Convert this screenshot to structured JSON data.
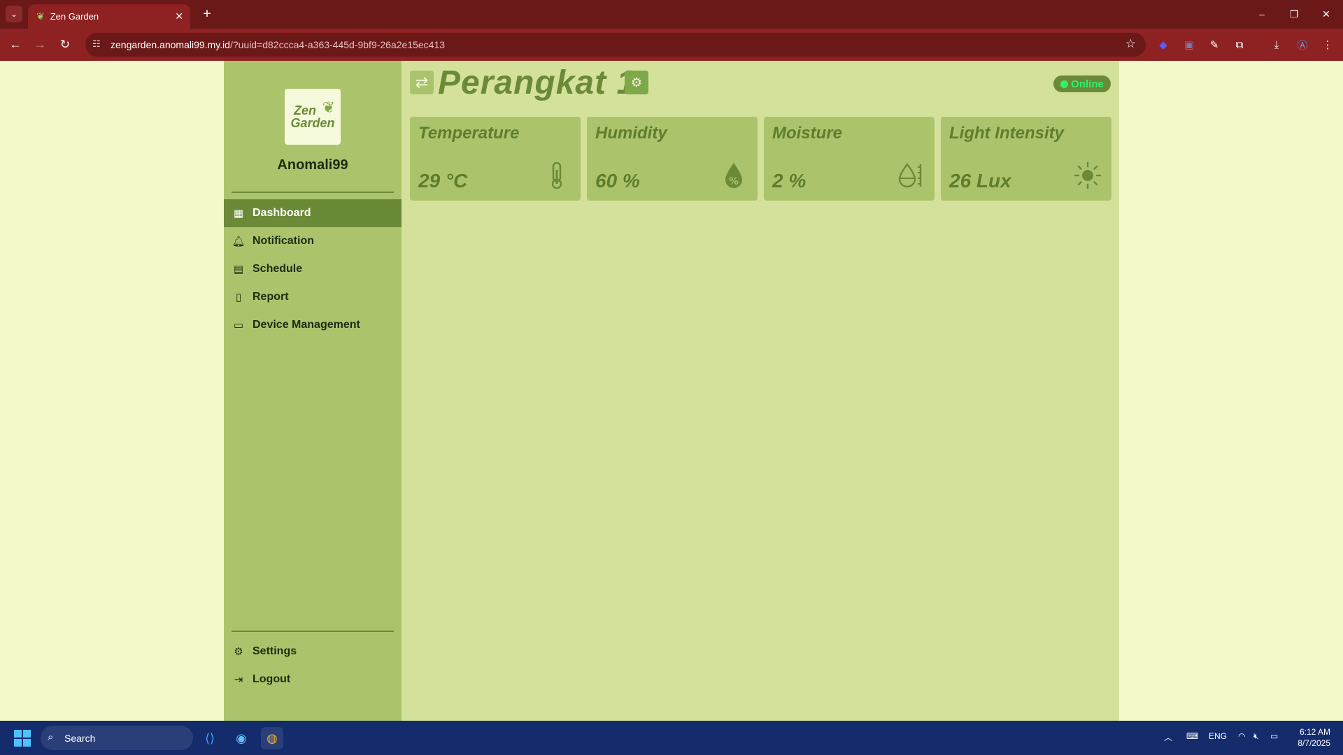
{
  "browser": {
    "tab_title": "Zen Garden",
    "url_host": "zengarden.anomali99.my.id",
    "url_rest": "/?uuid=d82ccca4-a363-445d-9bf9-26a2e15ec413"
  },
  "sidebar": {
    "logo_line1": "Zen",
    "logo_line2": "Garden",
    "username": "Anomali99",
    "items": [
      {
        "label": "Dashboard",
        "icon": "dashboard-icon"
      },
      {
        "label": "Notification",
        "icon": "bell-icon"
      },
      {
        "label": "Schedule",
        "icon": "calendar-icon"
      },
      {
        "label": "Report",
        "icon": "report-icon"
      },
      {
        "label": "Device Management",
        "icon": "tablet-icon"
      }
    ],
    "bottom_items": [
      {
        "label": "Settings",
        "icon": "gear-icon"
      },
      {
        "label": "Logout",
        "icon": "logout-icon"
      }
    ]
  },
  "main": {
    "device_name": "Perangkat 1",
    "status": "Online",
    "cards": [
      {
        "label": "Temperature",
        "value": "29 °C",
        "icon": "thermometer-icon"
      },
      {
        "label": "Humidity",
        "value": "60 %",
        "icon": "humidity-drop-icon"
      },
      {
        "label": "Moisture",
        "value": "2 %",
        "icon": "moisture-icon"
      },
      {
        "label": "Light Intensity",
        "value": "26 Lux",
        "icon": "sun-icon"
      }
    ]
  },
  "taskbar": {
    "search_label": "Search",
    "language": "ENG",
    "time": "6:12 AM",
    "date": "8/7/2025"
  },
  "colors": {
    "brand_dark": "#6b8a37",
    "sidebar_bg": "#abc46c",
    "main_bg": "#d3e19a",
    "page_bg": "#f3f9c8",
    "online": "#2ef26e",
    "browser_frame": "#8e2121"
  }
}
